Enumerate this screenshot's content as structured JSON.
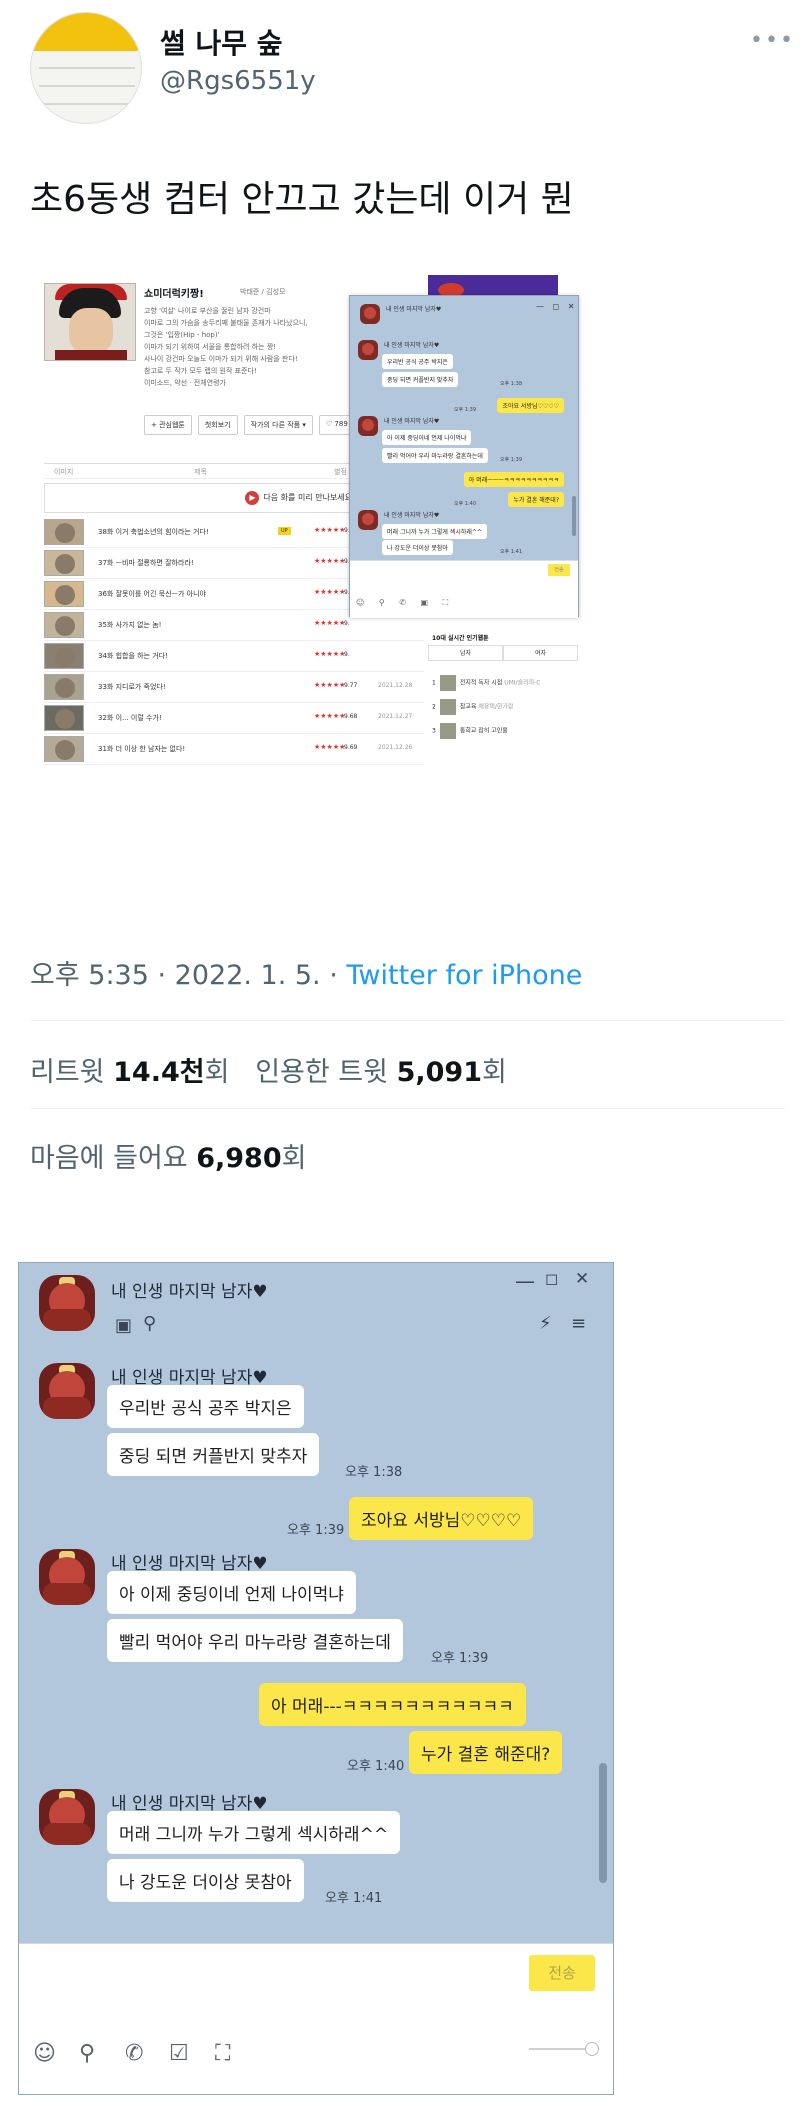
{
  "tweet": {
    "display_name": "썰 나무 숲",
    "handle": "@Rgs6551y",
    "text": "초6동생 컴터 안끄고 갔는데 이거 뭔",
    "time": "오후 5:35",
    "date": "2022. 1. 5.",
    "source": "Twitter for iPhone",
    "retweets_label": "리트윗",
    "retweets": "14.4천",
    "quotes_label": "인용한 트윗",
    "quotes": "5,091",
    "likes_label": "마음에 들어요",
    "likes": "6,980",
    "unit": "회",
    "more": "•••"
  },
  "webtoon": {
    "title": "쇼미더럭키짱!",
    "author": "박태준 / 김성모",
    "desc": [
      "고향 '여살' 나이로 부산을 꿇린 남자 강건마",
      "이마로 그의 가슴을 송두리째 불태울 존재가 나타났으니,",
      "그것은 '입짱(Hip - hop)'",
      "이마가 되기 위하여 서울을 통합하려 하는 짱!",
      "사나이 강건마 오늘도 이마가 되기 위해 사람을 판다!",
      "참고로 두 작가 모두 랩의 원작 표준다!",
      "이미소드, 약선 · 전체연령가"
    ],
    "buttons": [
      "+ 관심웹툰",
      "첫회보기",
      "작가의 다른 작품 ▾",
      "♡ 789"
    ],
    "col_headers": [
      "이미지",
      "제목",
      "별점"
    ],
    "banner": "다음 화를 미리 만나보세요.",
    "episodes": [
      {
        "title": "38화 이거 축법소년의 힘이라는 거다!",
        "badge": "UP",
        "rating": "9.",
        "date": ""
      },
      {
        "title": "37화 ㅡ비마 절룡하면 잘하라라!",
        "badge": "",
        "rating": "9.",
        "date": ""
      },
      {
        "title": "36화 잘못이를 어긴 묵신ㅡ가 아니야",
        "badge": "",
        "rating": "9.",
        "date": ""
      },
      {
        "title": "35화 사가지 없는 놈!",
        "badge": "",
        "rating": "9.",
        "date": ""
      },
      {
        "title": "34화 힙합을 하는 거다!",
        "badge": "",
        "rating": "9.",
        "date": ""
      },
      {
        "title": "33화 지디로가 죽었다!",
        "badge": "",
        "rating": "9.77",
        "date": "2021.12.28"
      },
      {
        "title": "32화 이... 이럴 수가!",
        "badge": "",
        "rating": "9.68",
        "date": "2021.12.27"
      },
      {
        "title": "31화 더 이상 한 남자는 없다!",
        "badge": "",
        "rating": "9.69",
        "date": "2021.12.26"
      }
    ],
    "stars": "★★★★★",
    "ranking_title": "10대 실시간 인기웹툰",
    "ranking_tabs": [
      "남자",
      "여자"
    ],
    "ranking": [
      {
        "rank": "1",
        "title": "전지적 독자 시점",
        "sub": "UMI/슬리피-C"
      },
      {
        "rank": "2",
        "title": "참교육",
        "sub": "채용택/한가람"
      },
      {
        "rank": "3",
        "title": "통희교 잡히 고인물",
        "sub": ""
      }
    ]
  },
  "small_chat": {
    "title": "내 인생 마지막 남자♥",
    "messages": [
      {
        "text": "우리반 공식 공주 박지은",
        "me": false
      },
      {
        "text": "중딩 되면 커플반지 맞추자",
        "me": false,
        "time": "오후 1:38"
      },
      {
        "text": "조아요 서방님♡♡♡♡",
        "me": true,
        "time": "오후 1:39"
      },
      {
        "text": "아 이제 중딩이네 언제 나이먹냐",
        "me": false
      },
      {
        "text": "빨리 먹어야 우리 마누라랑 결혼하는데",
        "me": false,
        "time": "오후 1:39"
      },
      {
        "text": "아 머래ㅡㅡㅡㅋㅋㅋㅋㅋㅋㅋㅋㅋㅋ",
        "me": true
      },
      {
        "text": "누가 결혼 해준대?",
        "me": true,
        "time": "오후 1:40"
      },
      {
        "text": "머래 그니까 누가 그렇게 섹시하래^^",
        "me": false
      },
      {
        "text": "나 강도운 더이상 못참아",
        "me": false,
        "time": "오후 1:41"
      }
    ],
    "send": "전송"
  },
  "big_chat": {
    "title": "내 인생 마지막 남자♥",
    "sender": "내 인생 마지막 남자♥",
    "controls": [
      "—",
      "◻",
      "✕"
    ],
    "msg1": "우리반 공식 공주 박지은",
    "msg2": "중딩 되면 커플반지 맞추자",
    "time1": "오후 1:38",
    "msg3": "조아요 서방님♡♡♡♡",
    "time2": "오후 1:39",
    "msg4": "아 이제 중딩이네 언제 나이먹냐",
    "msg5": "빨리 먹어야 우리 마누라랑 결혼하는데",
    "time3": "오후 1:39",
    "msg6": "아 머래---ㅋㅋㅋㅋㅋㅋㅋㅋㅋㅋㅋ",
    "msg7": "누가 결혼 해준대?",
    "time4": "오후 1:40",
    "msg8": "머래 그니까 누가 그렇게 섹시하래^^",
    "msg9": "나 강도운 더이상 못참아",
    "time5": "오후 1:41",
    "send": "전송"
  }
}
